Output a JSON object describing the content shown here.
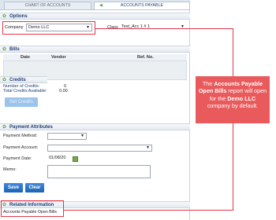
{
  "tabs": [
    {
      "label": "CHART OF ACCOUNTS"
    },
    {
      "label": "ACCOUNTS PAYABLE"
    }
  ],
  "options": {
    "title": "Options",
    "company_label": "Company",
    "company_value": "Demo LLC",
    "class_label": "Class",
    "class_value": "Test_Acc 1 # 1"
  },
  "bills": {
    "title": "Bills",
    "columns": [
      "Date",
      "Vendor",
      "Ref. No."
    ]
  },
  "credits": {
    "title": "Credits",
    "number_label": "Number of Credits:",
    "number_value": "0",
    "total_label": "Total Credits Available:",
    "total_value": "0.00",
    "set_button": "Set Credits"
  },
  "payment": {
    "title": "Payment Attributes",
    "method_label": "Payment Method:",
    "account_label": "Payment Account:",
    "date_label": "Payment Date:",
    "date_value": "01/08/20",
    "memo_label": "Memo:"
  },
  "actions": {
    "save": "Save",
    "clear": "Clear"
  },
  "related": {
    "title": "Related Information",
    "item": "Accounts Payable Open Bills"
  },
  "callout": {
    "text_1": "The ",
    "bold_1": "Accounts Payable Open Bills",
    "text_2": " report will open for the ",
    "bold_2": "Demo LLC",
    "text_3": " company by default."
  },
  "colors": {
    "accent": "#1f62b6",
    "highlight": "#e0364a",
    "callout_bg": "#e85a5c"
  }
}
